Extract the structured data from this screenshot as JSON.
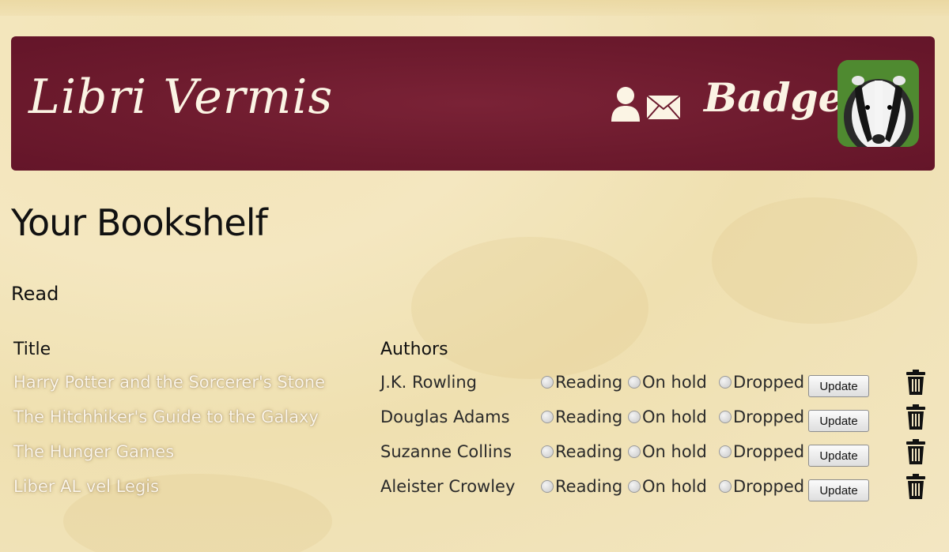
{
  "app": {
    "brand": "Libri Vermis",
    "username": "Badger"
  },
  "page": {
    "title": "Your Bookshelf",
    "section": "Read"
  },
  "table": {
    "headers": [
      "Title",
      "Authors"
    ],
    "status_options": [
      "Reading",
      "On hold",
      "Dropped"
    ],
    "update_label": "Update",
    "rows": [
      {
        "title": "Harry Potter and the Sorcerer's Stone",
        "author": "J.K. Rowling"
      },
      {
        "title": "The Hitchhiker's Guide to the Galaxy",
        "author": "Douglas Adams"
      },
      {
        "title": "The Hunger Games",
        "author": "Suzanne Collins"
      },
      {
        "title": "Liber AL vel Legis",
        "author": "Aleister Crowley"
      }
    ]
  },
  "icons": {
    "profile": "person-icon",
    "mail": "envelope-icon",
    "delete": "trash-icon"
  },
  "colors": {
    "header_bg": "#6c1a2d",
    "page_bg": "#f4e7c0",
    "header_text": "#fbf4e4"
  }
}
